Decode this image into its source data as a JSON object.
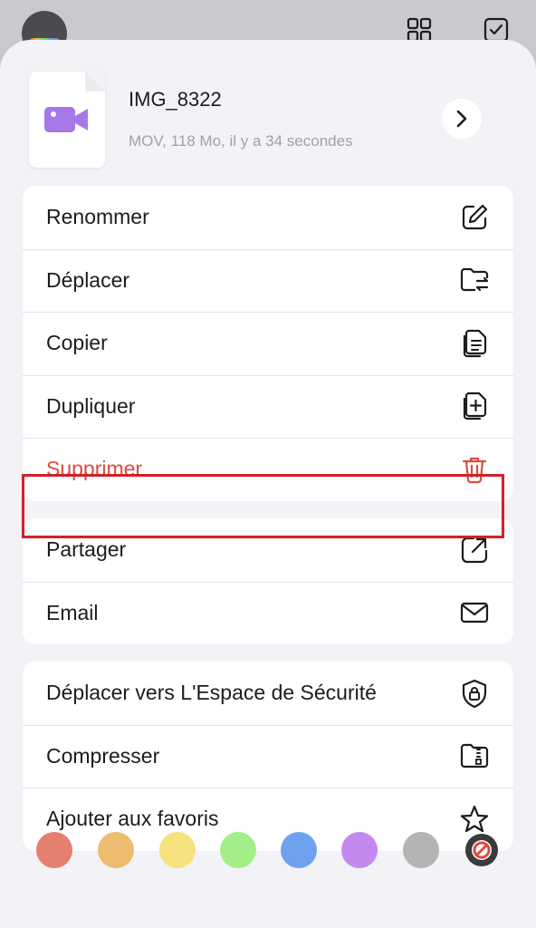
{
  "file": {
    "name": "IMG_8322",
    "meta": "MOV, 118 Mo, il y a 34 secondes"
  },
  "groups": [
    [
      {
        "label": "Renommer",
        "icon": "edit-icon"
      },
      {
        "label": "Déplacer",
        "icon": "move-folder-icon"
      },
      {
        "label": "Copier",
        "icon": "copy-icon"
      },
      {
        "label": "Dupliquer",
        "icon": "duplicate-icon"
      },
      {
        "label": "Supprimer",
        "icon": "trash-icon",
        "destructive": true
      }
    ],
    [
      {
        "label": "Partager",
        "icon": "share-icon"
      },
      {
        "label": "Email",
        "icon": "mail-icon"
      }
    ],
    [
      {
        "label": "Déplacer vers L'Espace de Sécurité",
        "icon": "shield-lock-icon"
      },
      {
        "label": "Compresser",
        "icon": "zip-folder-icon"
      },
      {
        "label": "Ajouter aux favoris",
        "icon": "star-icon"
      }
    ]
  ],
  "colors": {
    "accent_destructive": "#dc4b3c",
    "highlight_box": "#d42027",
    "tags": [
      "#e57f6f",
      "#edbc6e",
      "#f5e27d",
      "#a4ee8a",
      "#6fa2ee",
      "#c489ee",
      "#b4b4b4"
    ],
    "no_color_icon": "no-color-icon"
  }
}
